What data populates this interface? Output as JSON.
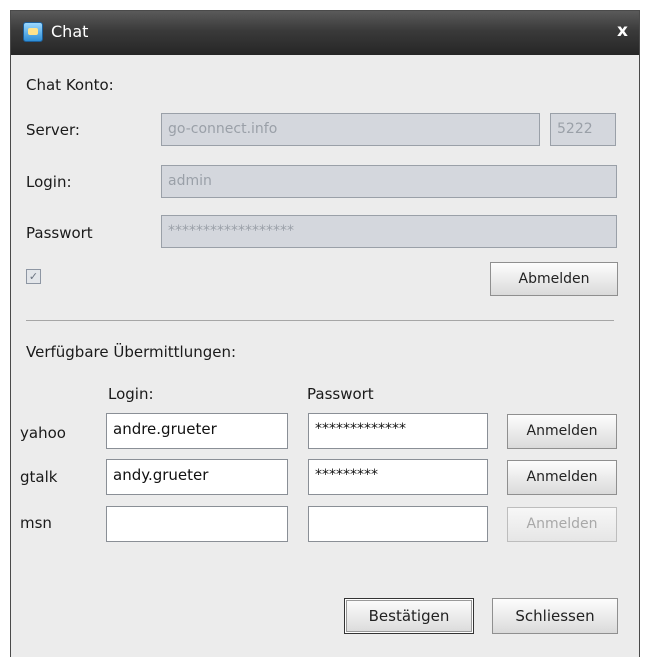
{
  "window": {
    "title": "Chat",
    "close_glyph": "x",
    "app_icon": "chat-phone-icon"
  },
  "account": {
    "section_label": "Chat Konto:",
    "server_label": "Server:",
    "server_value": "go-connect.info",
    "port_value": "5222",
    "login_label": "Login:",
    "login_value": "admin",
    "password_label": "Passwort",
    "password_value": "******************",
    "checkbox_checked": true,
    "checkbox_glyph": "✓",
    "logout_label": "Abmelden"
  },
  "transports": {
    "section_label": "Verfügbare Übermittlungen:",
    "login_header": "Login:",
    "password_header": "Passwort",
    "rows": [
      {
        "service": "yahoo",
        "login": "andre.grueter",
        "password": "*************",
        "button": "Anmelden",
        "enabled": true
      },
      {
        "service": "gtalk",
        "login": "andy.grueter",
        "password": "*********",
        "button": "Anmelden",
        "enabled": true
      },
      {
        "service": "msn",
        "login": "",
        "password": "",
        "button": "Anmelden",
        "enabled": false
      }
    ]
  },
  "footer": {
    "confirm_label": "Bestätigen",
    "close_label": "Schliessen"
  }
}
